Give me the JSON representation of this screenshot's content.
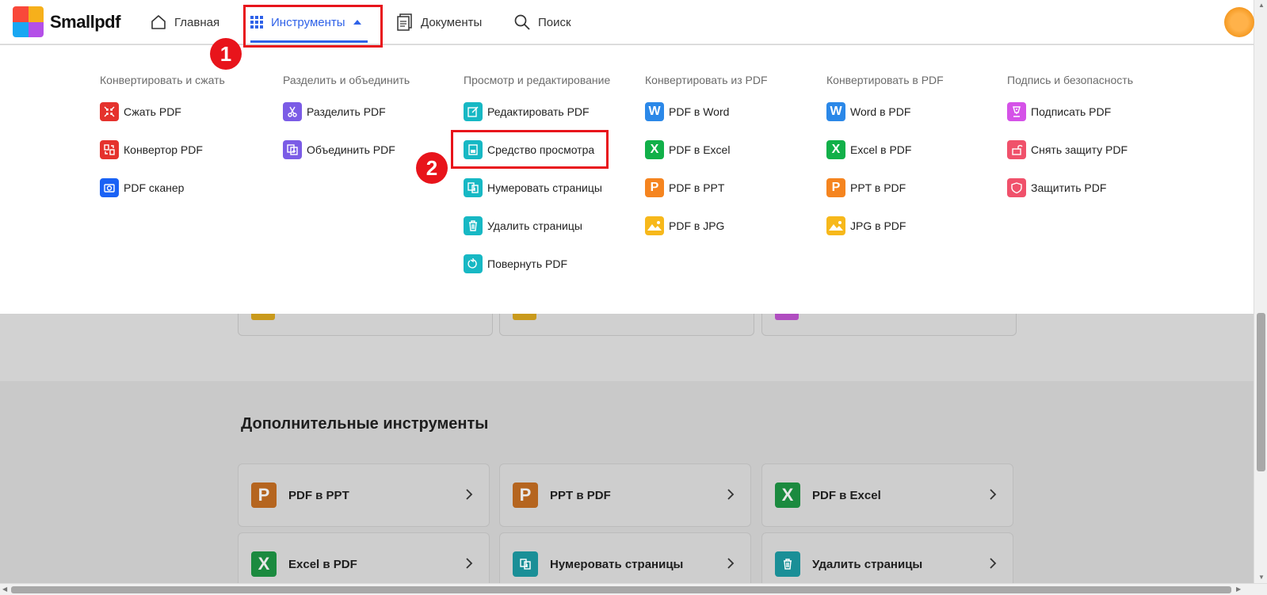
{
  "app": {
    "name": "Smallpdf"
  },
  "nav": {
    "home": "Главная",
    "tools": "Инструменты",
    "documents": "Документы",
    "search": "Поиск"
  },
  "annotations": {
    "one": "1",
    "two": "2"
  },
  "colors": {
    "accent": "#2f62e8",
    "annotation": "#e8141b"
  },
  "menu": {
    "columns": [
      {
        "title": "Конвертировать и сжать",
        "items": [
          {
            "label": "Сжать PDF",
            "icon": "compress-icon",
            "color": "#e5322d"
          },
          {
            "label": "Конвертор PDF",
            "icon": "convert-icon",
            "color": "#e5322d"
          },
          {
            "label": "PDF сканер",
            "icon": "camera-icon",
            "color": "#1a62f5"
          }
        ]
      },
      {
        "title": "Разделить и объединить",
        "items": [
          {
            "label": "Разделить PDF",
            "icon": "scissors-icon",
            "color": "#7b5ce6"
          },
          {
            "label": "Объединить PDF",
            "icon": "merge-icon",
            "color": "#7b5ce6"
          }
        ]
      },
      {
        "title": "Просмотр и редактирование",
        "items": [
          {
            "label": "Редактировать PDF",
            "icon": "edit-icon",
            "color": "#17b8c4"
          },
          {
            "label": "Средство просмотра",
            "icon": "viewer-icon",
            "color": "#17b8c4"
          },
          {
            "label": "Нумеровать страницы",
            "icon": "page-numbers-icon",
            "color": "#17b8c4"
          },
          {
            "label": "Удалить страницы",
            "icon": "trash-icon",
            "color": "#17b8c4"
          },
          {
            "label": "Повернуть PDF",
            "icon": "rotate-icon",
            "color": "#17b8c4"
          }
        ]
      },
      {
        "title": "Конвертировать из PDF",
        "items": [
          {
            "label": "PDF в Word",
            "icon": "word-icon",
            "color": "#2b88e8",
            "glyph": "W"
          },
          {
            "label": "PDF в Excel",
            "icon": "excel-icon",
            "color": "#11b049",
            "glyph": "X"
          },
          {
            "label": "PDF в PPT",
            "icon": "ppt-icon",
            "color": "#f5841f",
            "glyph": "P"
          },
          {
            "label": "PDF в JPG",
            "icon": "jpg-icon",
            "color": "#f7b81b"
          }
        ]
      },
      {
        "title": "Конвертировать в PDF",
        "items": [
          {
            "label": "Word в PDF",
            "icon": "word-icon",
            "color": "#2b88e8",
            "glyph": "W"
          },
          {
            "label": "Excel в PDF",
            "icon": "excel-icon",
            "color": "#11b049",
            "glyph": "X"
          },
          {
            "label": "PPT в PDF",
            "icon": "ppt-icon",
            "color": "#f5841f",
            "glyph": "P"
          },
          {
            "label": "JPG в PDF",
            "icon": "jpg-icon",
            "color": "#f7b81b"
          }
        ]
      },
      {
        "title": "Подпись и безопасность",
        "items": [
          {
            "label": "Подписать PDF",
            "icon": "sign-icon",
            "color": "#d552e8"
          },
          {
            "label": "Снять защиту PDF",
            "icon": "unlock-icon",
            "color": "#f0516b"
          },
          {
            "label": "Защитить PDF",
            "icon": "shield-icon",
            "color": "#f0516b"
          }
        ]
      }
    ]
  },
  "page": {
    "section_title": "Дополнительные инструменты",
    "cards": [
      {
        "label": "PDF в PPT",
        "icon": "ppt-icon",
        "color": "#b5651f",
        "glyph": "P"
      },
      {
        "label": "PPT в PDF",
        "icon": "ppt-icon",
        "color": "#b5651f",
        "glyph": "P"
      },
      {
        "label": "PDF в Excel",
        "icon": "excel-icon",
        "color": "#1b8a3f",
        "glyph": "X"
      },
      {
        "label": "Excel в PDF",
        "icon": "excel-icon",
        "color": "#1b8a3f",
        "glyph": "X"
      },
      {
        "label": "Нумеровать страницы",
        "icon": "page-numbers-icon",
        "color": "#1a8f97",
        "glyph": ""
      },
      {
        "label": "Удалить страницы",
        "icon": "trash-icon",
        "color": "#1a8f97",
        "glyph": ""
      }
    ]
  }
}
